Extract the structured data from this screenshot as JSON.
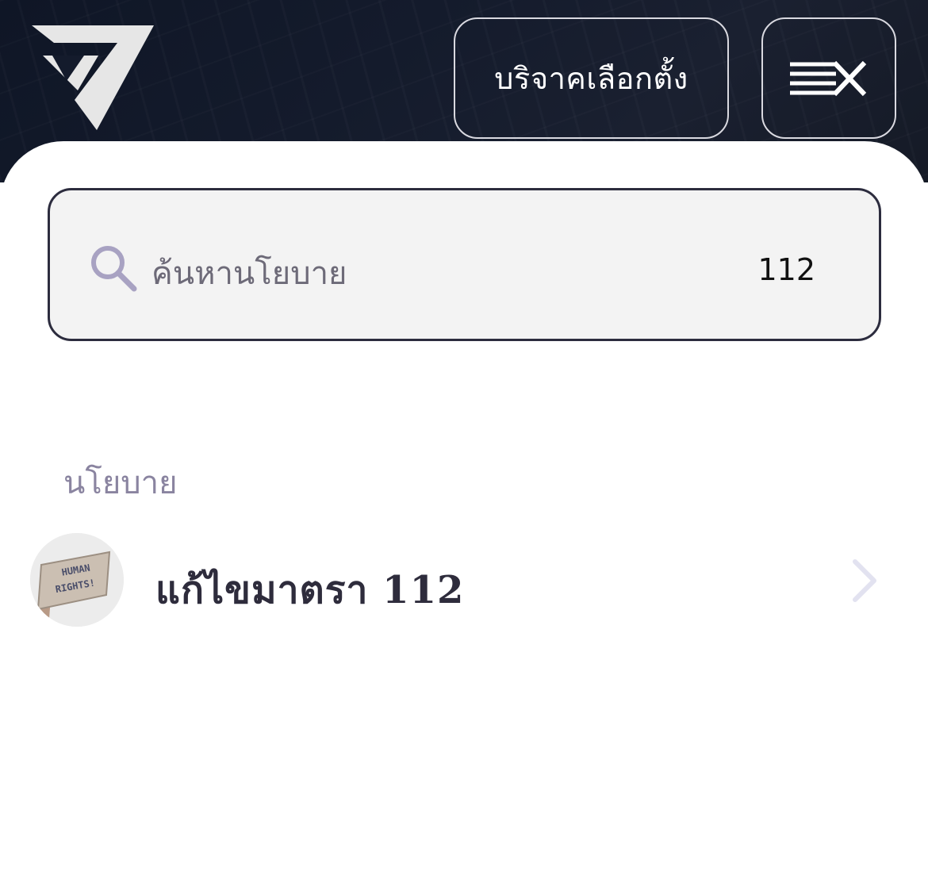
{
  "header": {
    "logo_icon": "party-logo-icon",
    "donate_label": "บริจาคเลือกตั้ง",
    "menu_icon": "menu-close-icon"
  },
  "search": {
    "placeholder": "ค้นหานโยบาย",
    "value": "112",
    "icon": "search-icon"
  },
  "results": {
    "section_title": "นโยบาย",
    "items": [
      {
        "label": "แก้ไขมาตรา 112",
        "thumbnail": "human-rights-sign-image",
        "icon": "chevron-right-icon"
      }
    ]
  },
  "colors": {
    "header_bg": "#141b2c",
    "panel_bg": "#ffffff",
    "search_bg": "#f3f3f3",
    "section_title": "#8a84a0",
    "chevron": "#e2e2f0"
  }
}
